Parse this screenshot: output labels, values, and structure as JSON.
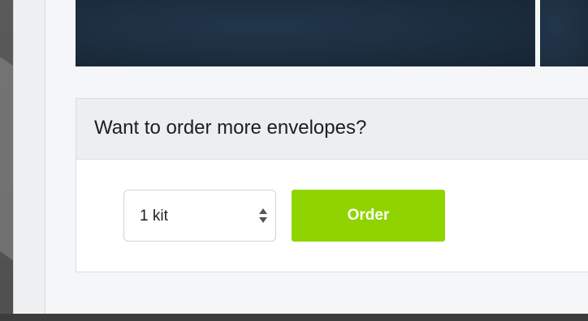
{
  "order_panel": {
    "title": "Want to order more envelopes?",
    "quantity_select": {
      "selected": "1 kit",
      "icon": "select-arrows-icon"
    },
    "order_button_label": "Order"
  },
  "colors": {
    "order_button": "#8fd400",
    "hero_banner": "#1b2c3d",
    "panel_header": "#eceeef"
  }
}
